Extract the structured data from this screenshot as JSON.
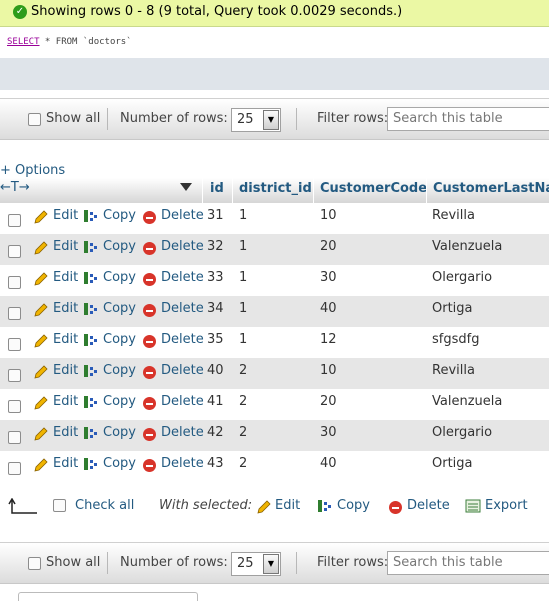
{
  "message": {
    "text": "Showing rows 0 - 8 (9 total, Query took 0.0029 seconds.)"
  },
  "query": {
    "keyword_select": "SELECT",
    "rest": " * FROM `doctors`"
  },
  "nav": {
    "show_all": "Show all",
    "rows_label": "Number of rows:",
    "rows_value": "25",
    "filter_label": "Filter rows:",
    "search_placeholder": "Search this table"
  },
  "table": {
    "options_label": "+ Options",
    "arrows": "←T→",
    "columns": [
      "id",
      "district_id",
      "CustomerCode",
      "CustomerLastNam"
    ],
    "actions": {
      "edit": "Edit",
      "copy": "Copy",
      "delete": "Delete"
    },
    "rows": [
      {
        "id": "31",
        "district_id": "1",
        "code": "10",
        "last": "Revilla"
      },
      {
        "id": "32",
        "district_id": "1",
        "code": "20",
        "last": "Valenzuela"
      },
      {
        "id": "33",
        "district_id": "1",
        "code": "30",
        "last": "Olergario"
      },
      {
        "id": "34",
        "district_id": "1",
        "code": "40",
        "last": "Ortiga"
      },
      {
        "id": "35",
        "district_id": "1",
        "code": "12",
        "last": "sfgsdfg"
      },
      {
        "id": "40",
        "district_id": "2",
        "code": "10",
        "last": "Revilla"
      },
      {
        "id": "41",
        "district_id": "2",
        "code": "20",
        "last": "Valenzuela"
      },
      {
        "id": "42",
        "district_id": "2",
        "code": "30",
        "last": "Olergario"
      },
      {
        "id": "43",
        "district_id": "2",
        "code": "40",
        "last": "Ortiga"
      }
    ]
  },
  "bulk": {
    "check_all": "Check all",
    "with_selected": "With selected:",
    "edit": "Edit",
    "copy": "Copy",
    "delete": "Delete",
    "export": "Export"
  },
  "colors": {
    "success_bg": "#ebf8a4",
    "link": "#235a81",
    "row_alt": "#e6e6e6"
  }
}
